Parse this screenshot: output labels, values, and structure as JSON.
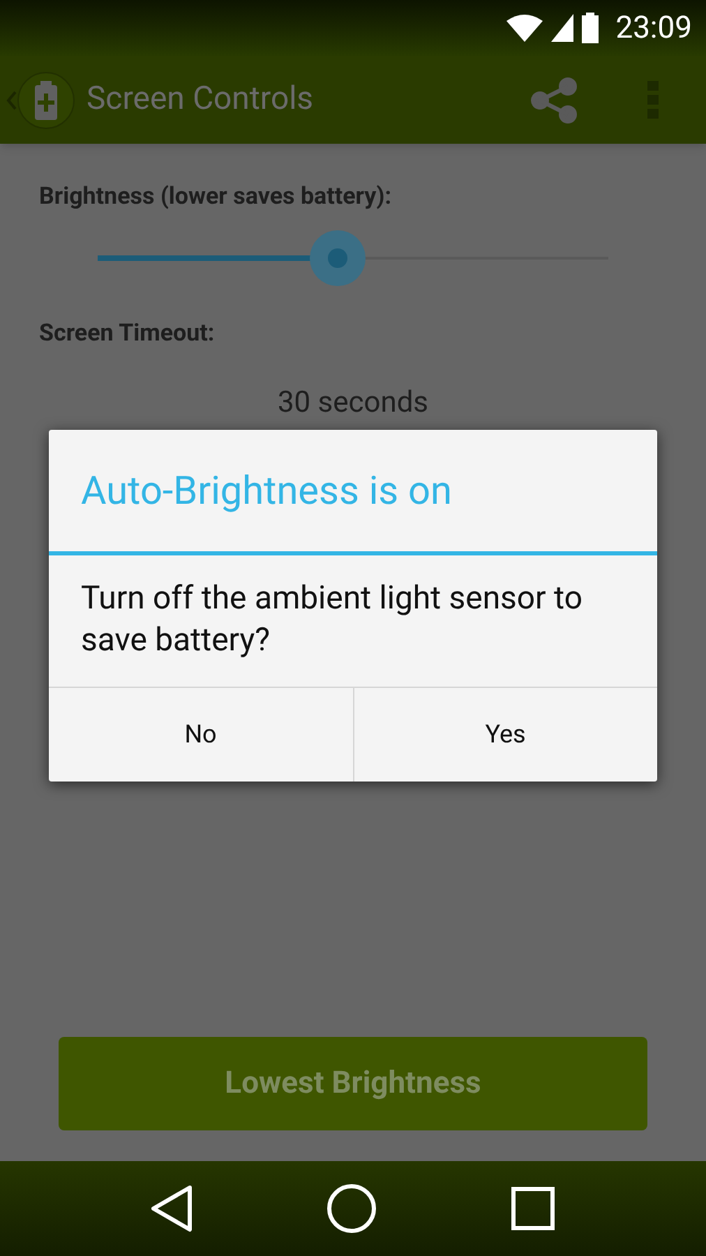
{
  "status_bar": {
    "time": "23:09"
  },
  "app_bar": {
    "title": "Screen Controls"
  },
  "brightness": {
    "label": "Brightness (lower saves battery):",
    "level": 0.47
  },
  "timeout": {
    "label": "Screen Timeout:",
    "value": "30 seconds"
  },
  "dialog": {
    "title": "Auto-Brightness is on",
    "message": "Turn off the ambient light sensor to save battery?",
    "buttons": [
      "No",
      "Yes"
    ]
  },
  "action_button": "Lowest Brightness"
}
